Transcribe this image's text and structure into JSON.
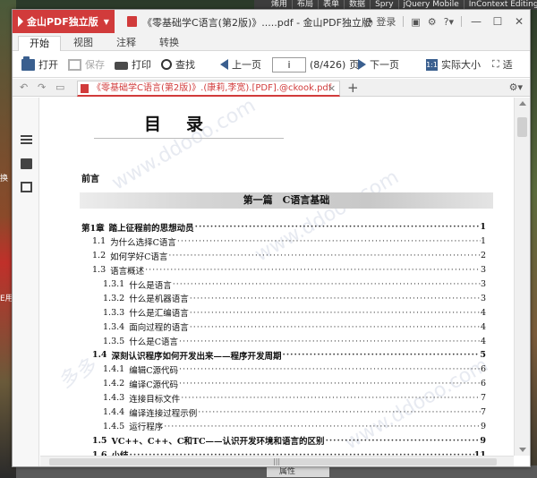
{
  "app": {
    "brand": "金山PDF独立版",
    "window_title": "《零基础学C语言(第2版)》.....pdf - 金山PDF独立版",
    "login": "登录"
  },
  "background": {
    "menu_items": [
      "烯用",
      "布局",
      "表单",
      "数据",
      "Spry",
      "jQuery Mobile",
      "InContext Editing"
    ],
    "left_labels": [
      "换",
      "E用"
    ],
    "properties_label": "属性"
  },
  "ribbon": {
    "tabs": [
      "开始",
      "视图",
      "注释",
      "转换"
    ],
    "active_tab": "开始"
  },
  "toolbar": {
    "open": "打开",
    "save": "保存",
    "print": "打印",
    "find": "查找",
    "prev_page": "上一页",
    "page_input": "i",
    "page_count": "(8/426)",
    "page_unit": "页",
    "next_page": "下一页",
    "actual_size": "实际大小",
    "fit": "适"
  },
  "doc_tab": {
    "title": "《零基础学C语言(第2版)》.(康莉,李宽).[PDF].@ckook.pdf",
    "close": "×",
    "add": "+"
  },
  "document": {
    "heading": "目录",
    "preface": "前言",
    "part": "第一篇　C语言基础",
    "watermark": "www.ddooo.com",
    "watermark2": "多多",
    "toc": [
      {
        "num": "第1章",
        "text": "踏上征程前的思想动员",
        "page": "1",
        "level": 0
      },
      {
        "num": "1.1",
        "text": "为什么选择C语言",
        "page": "1",
        "level": 1
      },
      {
        "num": "1.2",
        "text": "如何学好C语言",
        "page": "2",
        "level": 1
      },
      {
        "num": "1.3",
        "text": "语言概述",
        "page": "3",
        "level": 1
      },
      {
        "num": "1.3.1",
        "text": "什么是语言",
        "page": "3",
        "level": 2
      },
      {
        "num": "1.3.2",
        "text": "什么是机器语言",
        "page": "3",
        "level": 2
      },
      {
        "num": "1.3.3",
        "text": "什么是汇编语言",
        "page": "4",
        "level": 2
      },
      {
        "num": "1.3.4",
        "text": "面向过程的语言",
        "page": "4",
        "level": 2
      },
      {
        "num": "1.3.5",
        "text": "什么是C语言",
        "page": "4",
        "level": 2
      },
      {
        "num": "1.4",
        "text": "深刻认识程序如何开发出来——程序开发周期",
        "page": "5",
        "level": 1
      },
      {
        "num": "1.4.1",
        "text": "编辑C源代码",
        "page": "6",
        "level": 2
      },
      {
        "num": "1.4.2",
        "text": "编译C源代码",
        "page": "6",
        "level": 2
      },
      {
        "num": "1.4.3",
        "text": "连接目标文件",
        "page": "7",
        "level": 2
      },
      {
        "num": "1.4.4",
        "text": "编译连接过程示例",
        "page": "7",
        "level": 2
      },
      {
        "num": "1.4.5",
        "text": "运行程序",
        "page": "9",
        "level": 2
      },
      {
        "num": "1.5",
        "text": "VC++、C++、C和TC——认识开发环境和语言的区别",
        "page": "9",
        "level": 1
      },
      {
        "num": "1.6",
        "text": "小结",
        "page": "11",
        "level": 1
      }
    ]
  },
  "colors": {
    "brand_red": "#d13b3b",
    "accent_blue": "#3a5f8f"
  },
  "icons": {
    "open": "folder-open-icon",
    "save": "save-icon",
    "print": "printer-icon",
    "find": "magnifier-icon",
    "prev": "arrow-left-icon",
    "next": "arrow-right-icon"
  }
}
